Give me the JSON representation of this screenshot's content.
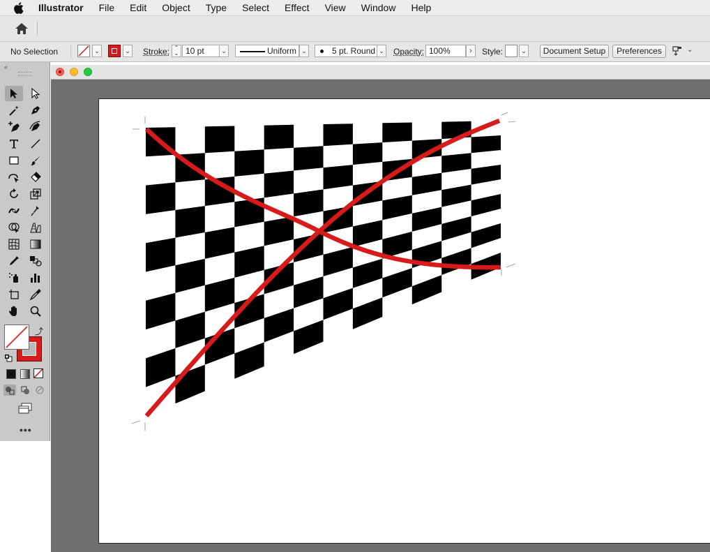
{
  "menubar": {
    "app_name": "Illustrator",
    "items": [
      "File",
      "Edit",
      "Object",
      "Type",
      "Select",
      "Effect",
      "View",
      "Window",
      "Help"
    ]
  },
  "control_bar": {
    "selection": "No Selection",
    "stroke_label": "Stroke:",
    "stroke_weight": "10 pt",
    "profile": "Uniform",
    "brush": "5 pt. Round",
    "opacity_label": "Opacity:",
    "opacity": "100%",
    "style_label": "Style:",
    "document_setup": "Document Setup",
    "preferences": "Preferences"
  },
  "colors": {
    "stroke": "#d71a1a",
    "checker": "#000000",
    "panel_bg": "#c9c9c9",
    "canvas_bg": "#6f6f6f"
  },
  "tools": [
    "selection-tool",
    "direct-selection-tool",
    "magic-wand-tool",
    "pen-tool",
    "add-anchor-tool",
    "curvature-tool",
    "type-tool",
    "line-tool",
    "rectangle-tool",
    "paintbrush-tool",
    "shaper-tool",
    "eraser-tool",
    "rotate-tool",
    "scale-tool",
    "width-tool",
    "puppet-warp-tool",
    "shape-builder-tool",
    "perspective-grid-tool",
    "mesh-tool",
    "gradient-tool",
    "eyedropper-tool",
    "blend-tool",
    "symbol-sprayer-tool",
    "column-graph-tool",
    "artboard-tool",
    "slice-tool",
    "hand-tool",
    "zoom-tool"
  ]
}
